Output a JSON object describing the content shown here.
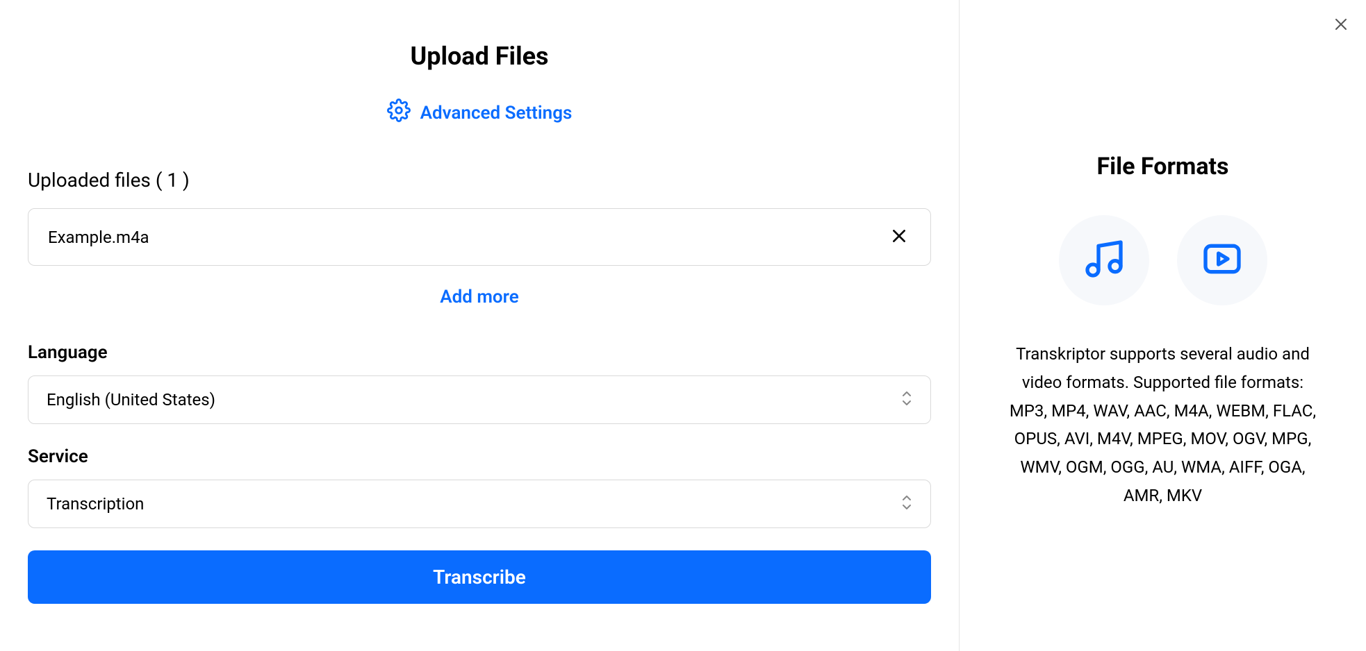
{
  "header": {
    "title": "Upload Files",
    "advanced_settings_label": "Advanced Settings"
  },
  "uploaded": {
    "section_label": "Uploaded files ( 1 )",
    "files": [
      {
        "name": "Example.m4a"
      }
    ],
    "add_more_label": "Add more"
  },
  "language": {
    "label": "Language",
    "selected": "English (United States)"
  },
  "service": {
    "label": "Service",
    "selected": "Transcription"
  },
  "actions": {
    "transcribe_label": "Transcribe"
  },
  "sidebar": {
    "title": "File Formats",
    "description": "Transkriptor supports several audio and video formats. Supported file formats: MP3, MP4, WAV, AAC, M4A, WEBM, FLAC, OPUS, AVI, M4V, MPEG, MOV, OGV, MPG, WMV, OGM, OGG, AU, WMA, AIFF, OGA, AMR, MKV"
  }
}
